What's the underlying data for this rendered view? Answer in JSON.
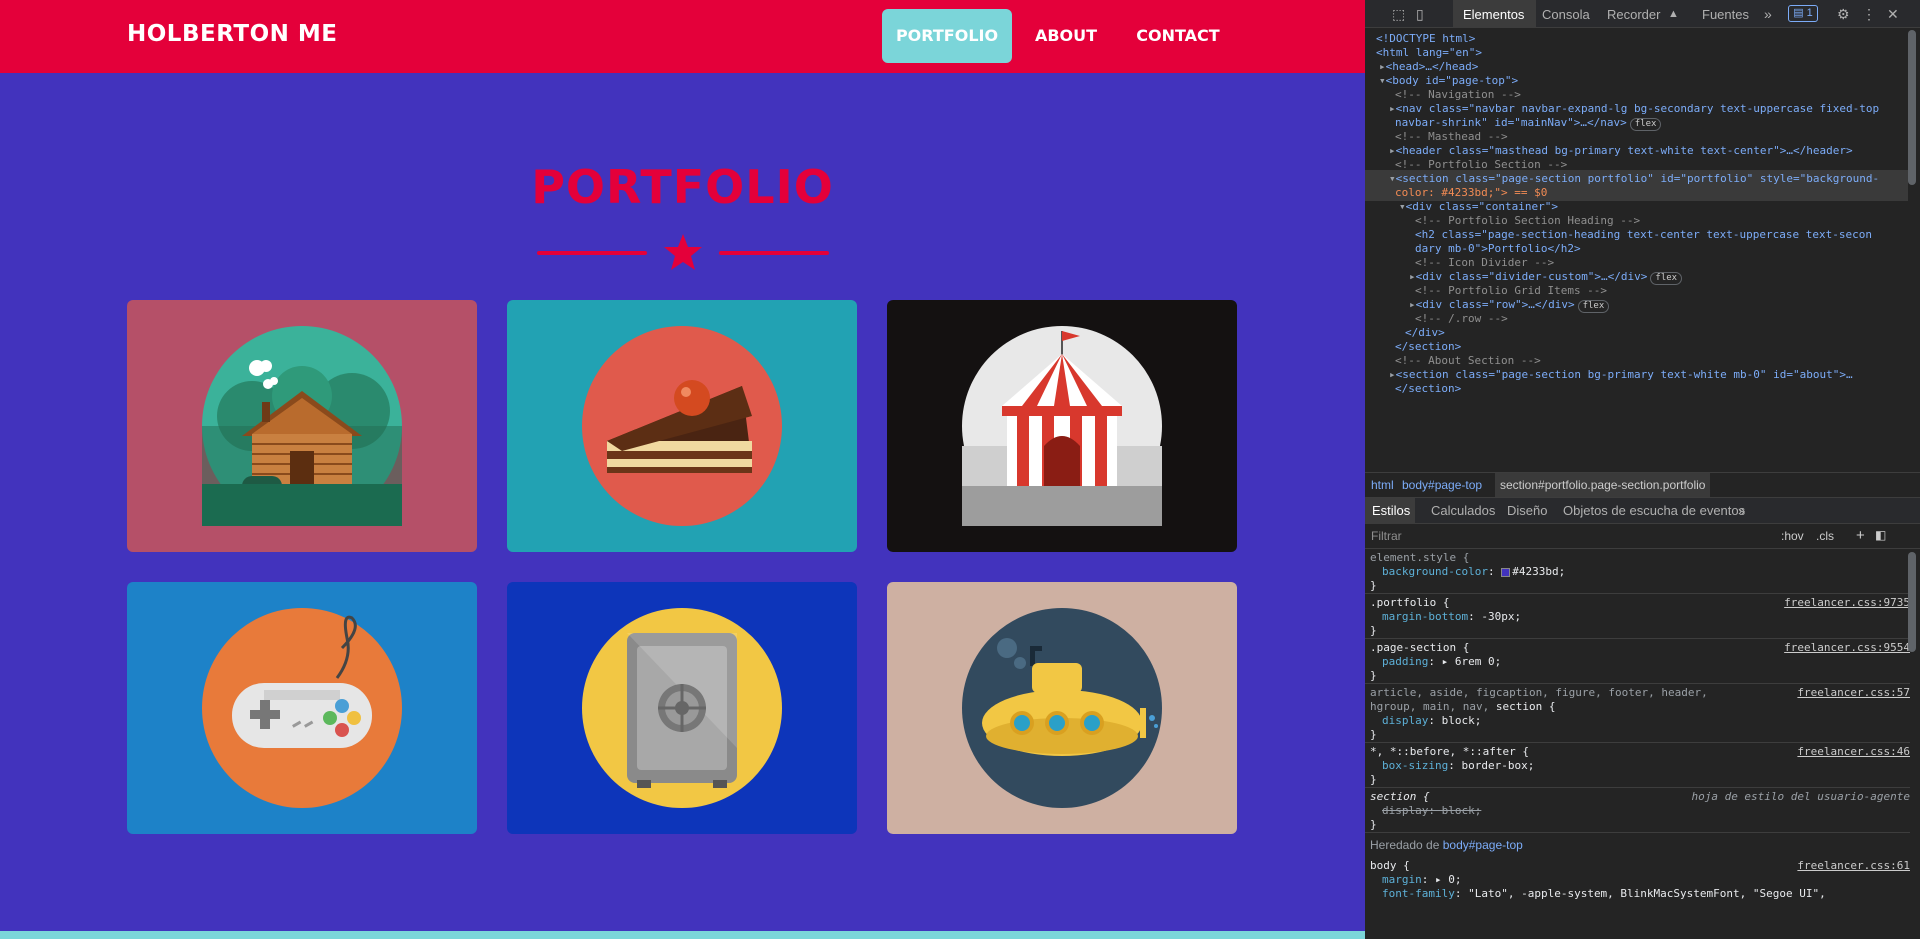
{
  "site": {
    "brand": "HOLBERTON ME",
    "nav": {
      "portfolio": "PORTFOLIO",
      "about": "ABOUT",
      "contact": "CONTACT"
    },
    "section_heading": "PORTFOLIO",
    "colors": {
      "background": "#4233bd",
      "navbar": "#e4003a",
      "accent": "#7bd5d9",
      "heading": "#e4003a"
    },
    "cards": [
      {
        "name": "cabin",
        "bg": "#b55068"
      },
      {
        "name": "cake",
        "bg": "#22a2b3"
      },
      {
        "name": "circus",
        "bg": "#141111"
      },
      {
        "name": "game-controller",
        "bg": "#1d82c8"
      },
      {
        "name": "safe",
        "bg": "#0d35ba"
      },
      {
        "name": "submarine",
        "bg": "#ceb0a2"
      }
    ]
  },
  "devtools": {
    "tabs": {
      "elements": "Elementos",
      "console": "Consola",
      "recorder": "Recorder",
      "sources": "Fuentes",
      "badge": "1"
    },
    "dom": {
      "doctype": "<!DOCTYPE html>",
      "html_open": "<html lang=\"en\">",
      "head": "<head>…</head>",
      "body_open": "<body id=\"page-top\">",
      "c_nav": "<!-- Navigation -->",
      "nav_1": "<nav class=\"navbar navbar-expand-lg bg-secondary text-uppercase fixed-top",
      "nav_2": "navbar-shrink\" id=\"mainNav\">…</nav>",
      "c_masthead": "<!-- Masthead -->",
      "header": "<header class=\"masthead bg-primary text-white text-center\">…</header>",
      "c_portfolio": "<!-- Portfolio Section -->",
      "section_1": "<section class=\"page-section portfolio\" id=\"portfolio\" style=\"background-",
      "section_2": "color: #4233bd;\"> == $0",
      "container": "<div class=\"container\">",
      "c_heading": "<!-- Portfolio Section Heading -->",
      "h2_1": "<h2 class=\"page-section-heading text-center text-uppercase text-secon",
      "h2_2": "dary mb-0\">Portfolio</h2>",
      "c_icon": "<!-- Icon Divider -->",
      "divider": "<div class=\"divider-custom\">…</div>",
      "c_grid": "<!-- Portfolio Grid Items -->",
      "row": "<div class=\"row\">…</div>",
      "c_row_end": "<!-- /.row -->",
      "div_close": "</div>",
      "section_close": "</section>",
      "c_about": "<!-- About Section -->",
      "about_section": "<section class=\"page-section bg-primary text-white mb-0\" id=\"about\">…",
      "about_close": "</section>",
      "flex": "flex"
    },
    "breadcrumb": [
      "html",
      "body#page-top",
      "section#portfolio.page-section.portfolio"
    ],
    "styles_tabs": {
      "styles": "Estilos",
      "computed": "Calculados",
      "layout": "Diseño",
      "listeners": "Objetos de escucha de eventos"
    },
    "filter": {
      "placeholder": "Filtrar",
      "hov": ":hov",
      "cls": ".cls",
      "plus": "+"
    },
    "rules": {
      "r1_selector": "element.style {",
      "r1_prop": "background-color",
      "r1_val": "#4233bd;",
      "r2_selector": ".portfolio {",
      "r2_src": "freelancer.css:9735",
      "r2_prop": "margin-bottom",
      "r2_val": "-30px;",
      "r3_selector": ".page-section {",
      "r3_src": "freelancer.css:9554",
      "r3_prop": "padding",
      "r3_val": "▸ 6rem 0;",
      "r4_selector_1": "article, aside, figcaption, figure, footer, header,",
      "r4_selector_2a": "hgroup, main, nav, ",
      "r4_selector_2b": "section {",
      "r4_src": "freelancer.css:57",
      "r4_prop": "display",
      "r4_val": "block;",
      "r5_selector": "*, *::before, *::after {",
      "r5_src": "freelancer.css:46",
      "r5_prop": "box-sizing",
      "r5_val": "border-box;",
      "r6_selector": "section {",
      "r6_src": "hoja de estilo del usuario-agente",
      "r6_strike": "display: block;",
      "inherited_label": "Heredado de ",
      "inherited_link": "body#page-top",
      "r7_selector": "body {",
      "r7_src": "freelancer.css:61",
      "r7_prop1": "margin",
      "r7_val1": "▸ 0;",
      "r7_prop2": "font-family",
      "r7_val2": "\"Lato\", -apple-system, BlinkMacSystemFont, \"Segoe UI\",",
      "close": "}"
    }
  }
}
